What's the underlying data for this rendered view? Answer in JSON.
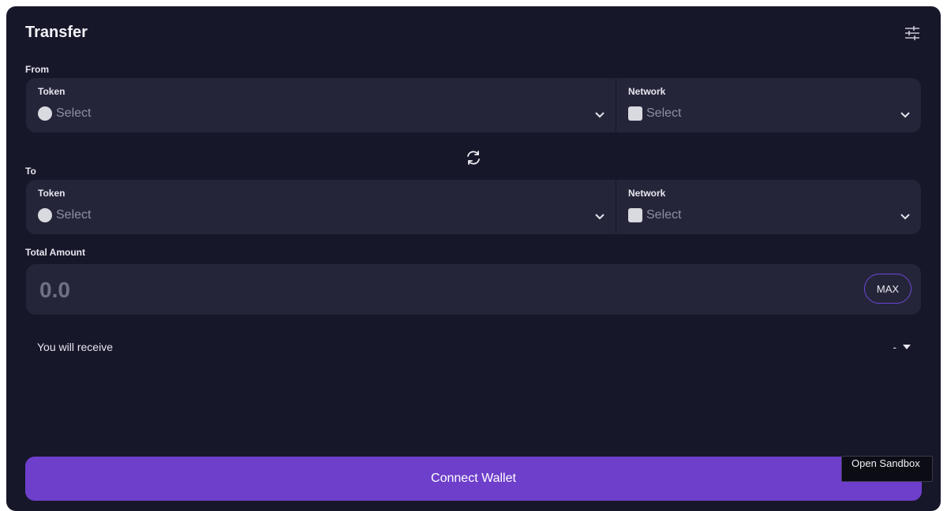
{
  "header": {
    "title": "Transfer",
    "settings_icon": "sliders-icon"
  },
  "from": {
    "label": "From",
    "token": {
      "label": "Token",
      "value": "Select"
    },
    "network": {
      "label": "Network",
      "value": "Select"
    }
  },
  "swap_icon": "swap-arrows-icon",
  "to": {
    "label": "To",
    "token": {
      "label": "Token",
      "value": "Select"
    },
    "network": {
      "label": "Network",
      "value": "Select"
    }
  },
  "amount": {
    "label": "Total Amount",
    "placeholder": "0.0",
    "value": "",
    "max_label": "MAX"
  },
  "receive": {
    "label": "You will receive",
    "value": "-"
  },
  "connect_button": "Connect Wallet",
  "sandbox_button": "Open Sandbox",
  "colors": {
    "background": "#17172a",
    "panel": "#25253a",
    "accent": "#6e3fcb",
    "max_border": "#6d46d8"
  }
}
